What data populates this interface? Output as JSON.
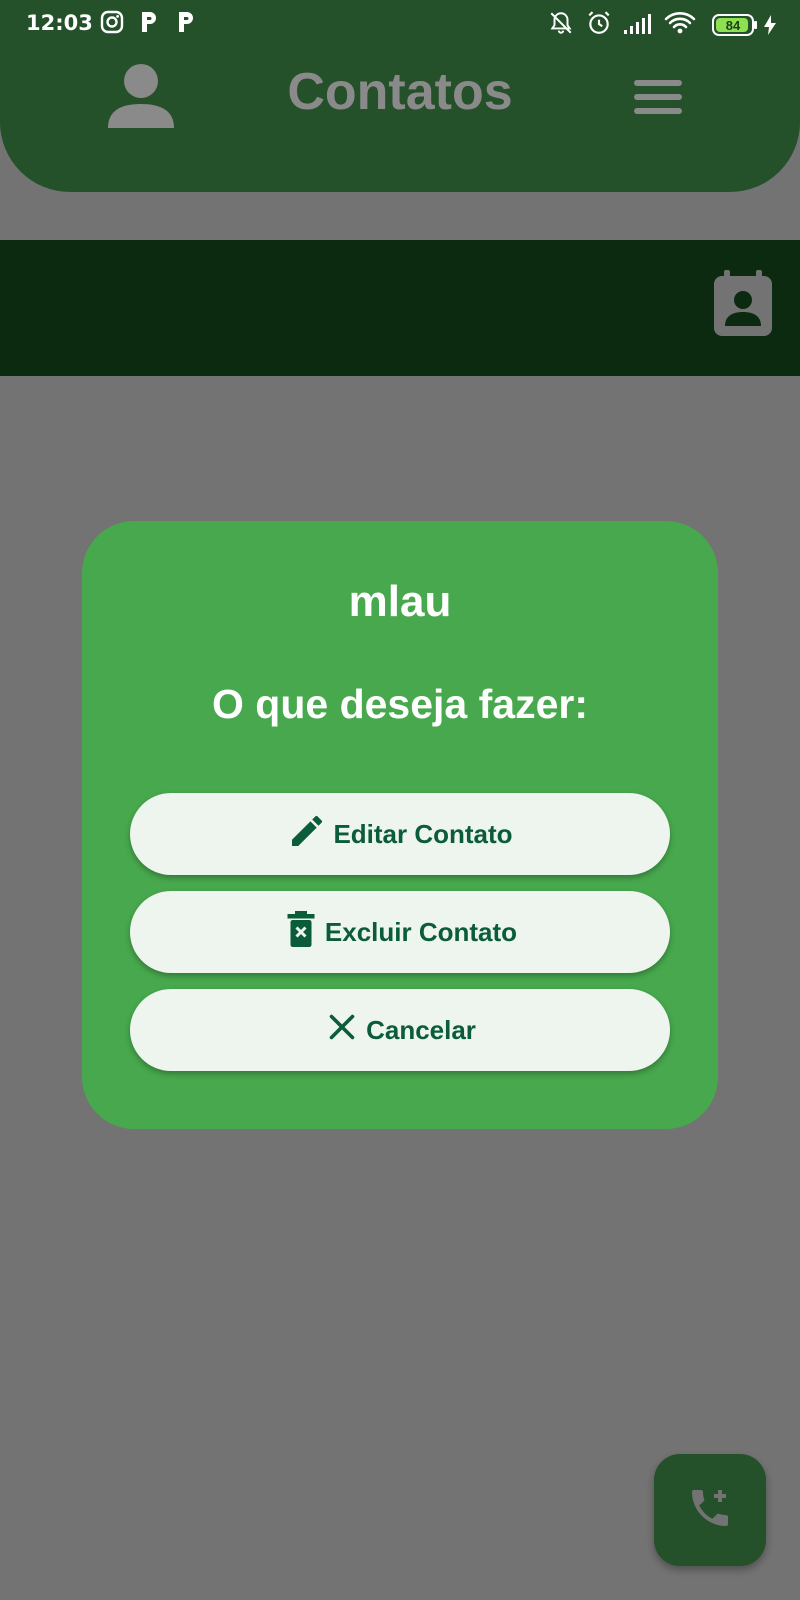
{
  "status_bar": {
    "time": "12:03",
    "battery": "84",
    "icons": [
      "instagram-icon",
      "p-app-icon",
      "p-app-icon",
      "bell-off-icon",
      "alarm-icon",
      "signal-icon",
      "wifi-icon",
      "battery-icon",
      "charging-icon"
    ]
  },
  "header": {
    "title": "Contatos",
    "left_icon": "person-icon",
    "right_icon": "menu-icon",
    "color": "#24502a"
  },
  "tabbar": {
    "icon": "contact-calendar-icon",
    "color": "#0c2a10"
  },
  "dialog": {
    "contact_name": "mlau",
    "question": "O que deseja fazer:",
    "background": "#47a84d",
    "buttons": [
      {
        "label": "Editar Contato",
        "icon": "pencil-icon"
      },
      {
        "label": "Excluir Contato",
        "icon": "trash-icon"
      },
      {
        "label": "Cancelar",
        "icon": "close-icon"
      }
    ]
  },
  "fab": {
    "icon": "add-call-icon"
  },
  "colors": {
    "scrim": "#737373",
    "button_bg": "#eef5ee",
    "button_text": "#0b5c38"
  }
}
